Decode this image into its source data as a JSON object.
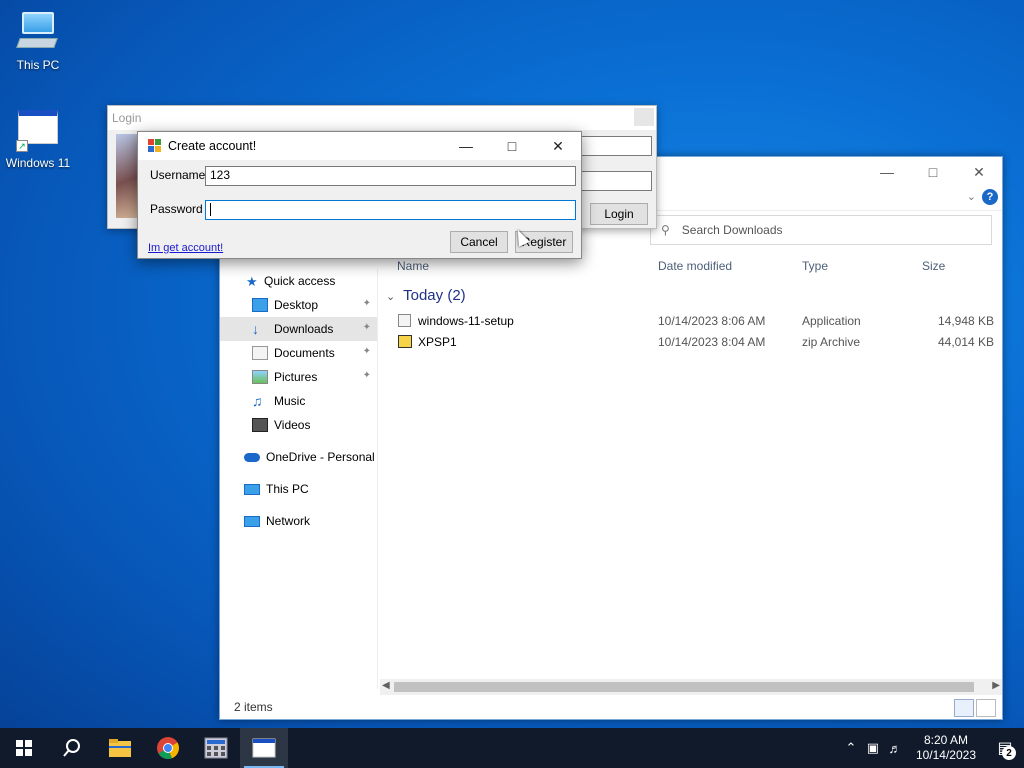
{
  "desktop": {
    "icons": [
      {
        "label": "This PC"
      },
      {
        "label": "Windows 11"
      }
    ]
  },
  "explorer": {
    "search_placeholder": "Search Downloads",
    "nav": {
      "quick_access": "Quick access",
      "desktop": "Desktop",
      "downloads": "Downloads",
      "documents": "Documents",
      "pictures": "Pictures",
      "music": "Music",
      "videos": "Videos",
      "onedrive": "OneDrive - Personal",
      "this_pc": "This PC",
      "network": "Network"
    },
    "columns": {
      "name": "Name",
      "date": "Date modified",
      "type": "Type",
      "size": "Size"
    },
    "group": "Today (2)",
    "files": [
      {
        "name": "windows-11-setup",
        "date": "10/14/2023 8:06 AM",
        "type": "Application",
        "size": "14,948 KB"
      },
      {
        "name": "XPSP1",
        "date": "10/14/2023 8:04 AM",
        "type": "zip Archive",
        "size": "44,014 KB"
      }
    ],
    "status": "2 items"
  },
  "login": {
    "title": "Login",
    "login_button": "Login"
  },
  "create_account": {
    "title": "Create account!",
    "username_label": "Username",
    "username_value": "123",
    "password_label": "Password",
    "password_value": "",
    "cancel": "Cancel",
    "register": "Register",
    "link": "Im get account!"
  },
  "taskbar": {
    "time": "8:20 AM",
    "date": "10/14/2023",
    "notifications": "2"
  }
}
